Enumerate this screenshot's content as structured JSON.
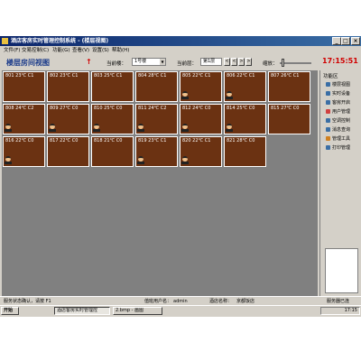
{
  "window": {
    "title": "酒店客房实时管理控制系统 - (楼层视图)",
    "title_buttons": [
      "_",
      "□",
      "×"
    ]
  },
  "menu": [
    "文件(F)",
    "交易控制(C)",
    "功能(G)",
    "查看(V)",
    "设置(S)",
    "帮助(H)"
  ],
  "toolbar": {
    "page_title": "楼层房间视图",
    "red_marker": "↑",
    "building_label": "当前楼：",
    "building_value": "1号楼",
    "floor_label": "当前层：",
    "floor_value": "第1层",
    "nav_buttons": [
      "<",
      "<",
      ">",
      ">"
    ],
    "zoom_label": "缩放：",
    "clock": "17:15:51"
  },
  "rooms": [
    {
      "label": "801  23℃ C1",
      "occupied": false
    },
    {
      "label": "802  23℃ C1",
      "occupied": false
    },
    {
      "label": "803  25℃ C1",
      "occupied": false
    },
    {
      "label": "804  28℃ C1",
      "occupied": false
    },
    {
      "label": "805  22℃ C1",
      "occupied": true
    },
    {
      "label": "806  22℃ C1",
      "occupied": true
    },
    {
      "label": "807  26℃ C1",
      "occupied": false
    },
    {
      "label": "808  24℃ C2",
      "occupied": true
    },
    {
      "label": "809  27℃ C0",
      "occupied": true
    },
    {
      "label": "810  25℃ C0",
      "occupied": true
    },
    {
      "label": "811  24℃ C2",
      "occupied": true
    },
    {
      "label": "812  24℃ C0",
      "occupied": true
    },
    {
      "label": "814  25℃ C0",
      "occupied": true
    },
    {
      "label": "815  27℃ C0",
      "occupied": false
    },
    {
      "label": "816  22℃ C0",
      "occupied": true
    },
    {
      "label": "817  22℃ C0",
      "occupied": false
    },
    {
      "label": "818  21℃ C0",
      "occupied": false
    },
    {
      "label": "819  23℃ C1",
      "occupied": true
    },
    {
      "label": "820  22℃ C1",
      "occupied": true
    },
    {
      "label": "821  28℃ C0",
      "occupied": false
    }
  ],
  "function_panel": {
    "title": "功能区",
    "items": [
      {
        "label": "楼层视图",
        "icon": "building-icon",
        "color": "#3a6ea5"
      },
      {
        "label": "实时设备",
        "icon": "device-icon",
        "color": "#3a6ea5"
      },
      {
        "label": "客房开启",
        "icon": "door-icon",
        "color": "#3a6ea5"
      },
      {
        "label": "用户管理",
        "icon": "user-icon",
        "color": "#d04040"
      },
      {
        "label": "空调控制",
        "icon": "aircon-icon",
        "color": "#3a6ea5"
      },
      {
        "label": "消息查询",
        "icon": "message-icon",
        "color": "#3a6ea5"
      },
      {
        "label": "管理工具",
        "icon": "tool-icon",
        "color": "#d08020"
      },
      {
        "label": "打印管理",
        "icon": "printer-icon",
        "color": "#3a6ea5"
      }
    ]
  },
  "status_bar": {
    "left": "服务状态确认，请按 F1",
    "user_label": "值班用户名：",
    "user_value": "admin",
    "location_label": "酒店名称：",
    "location_value": "京都饭店",
    "right": "服务器已连"
  },
  "taskbar": {
    "start": "开始",
    "tasks": [
      "酒店客房实时管理控",
      "2.bmp - 画图"
    ],
    "active_task_index": 0,
    "time": "17:15"
  },
  "colors": {
    "room_bg": "#6b3212",
    "grid_bg": "#808080",
    "title_gradient_start": "#0a246a",
    "clock": "#d00000"
  }
}
